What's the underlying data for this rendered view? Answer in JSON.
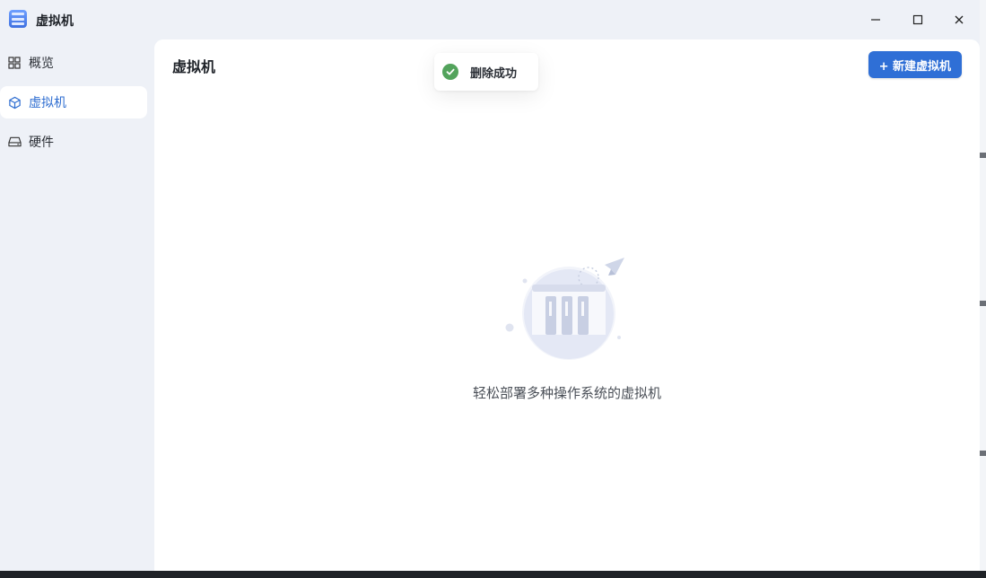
{
  "window": {
    "title": "虚拟机",
    "minimize_label": "minimize",
    "maximize_label": "maximize",
    "close_label": "close"
  },
  "sidebar": {
    "items": [
      {
        "label": "概览",
        "icon": "grid-icon",
        "active": false
      },
      {
        "label": "虚拟机",
        "icon": "cube-icon",
        "active": true
      },
      {
        "label": "硬件",
        "icon": "drive-icon",
        "active": false
      }
    ]
  },
  "main": {
    "title": "虚拟机",
    "new_button_label": "+ 新建虚拟机",
    "empty_text": "轻松部署多种操作系统的虚拟机"
  },
  "toast": {
    "message": "删除成功",
    "icon": "check-circle-icon"
  },
  "colors": {
    "accent": "#2f6fd6",
    "sidebar_bg": "#eef1f7",
    "active_text": "#2f6ed1",
    "success": "#53a35c"
  }
}
